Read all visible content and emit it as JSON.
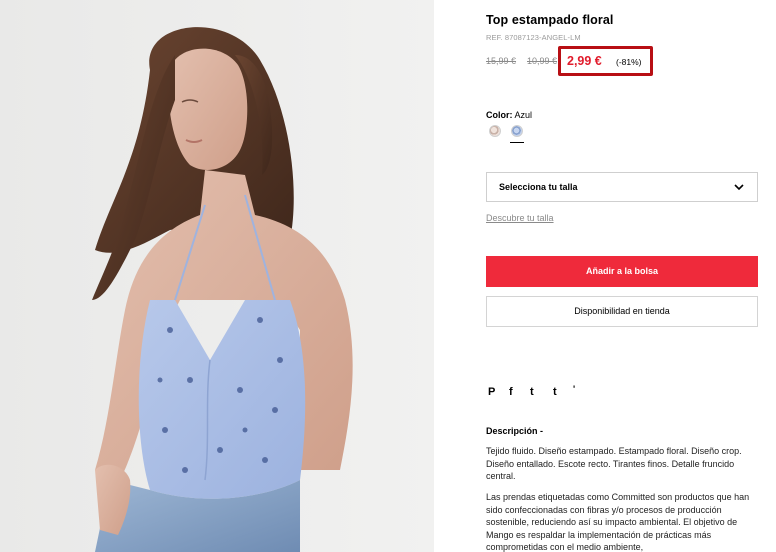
{
  "product": {
    "title": "Top estampado floral",
    "ref": "REF. 87087123-ANGEL-LM"
  },
  "price": {
    "original": "15,99 €",
    "previous": "10,99 €",
    "current": "2,99 €",
    "discount": "(-81%)",
    "highlight_color": "#b80f14",
    "sale_color": "#e11c2c"
  },
  "color": {
    "label": "Color:",
    "selected": "Azul",
    "swatches": [
      "beige",
      "azul"
    ]
  },
  "size": {
    "select_label": "Selecciona tu talla",
    "guide_link": "Descubre tu talla"
  },
  "actions": {
    "add_to_bag": "Añadir a la bolsa",
    "store_availability": "Disponibilidad en tienda",
    "accent": "#ef2a3b"
  },
  "social": {
    "icons": [
      "pinterest-icon",
      "facebook-icon",
      "twitter-icon",
      "tumblr-icon"
    ],
    "glyphs": [
      "P",
      "f",
      "t",
      "t",
      "'"
    ]
  },
  "description": {
    "title": "Descripción -",
    "text": "Tejido fluido. Diseño estampado. Estampado floral. Diseño crop. Diseño entallado. Escote recto. Tirantes finos. Detalle fruncido central.",
    "committed": "Las prendas etiquetadas como Committed son productos que han sido confeccionadas con fibras y/o procesos de producción sostenible, reduciendo así su impacto ambiental. El objetivo de Mango es respaldar la implementación de prácticas más comprometidas con el medio ambiente,"
  }
}
